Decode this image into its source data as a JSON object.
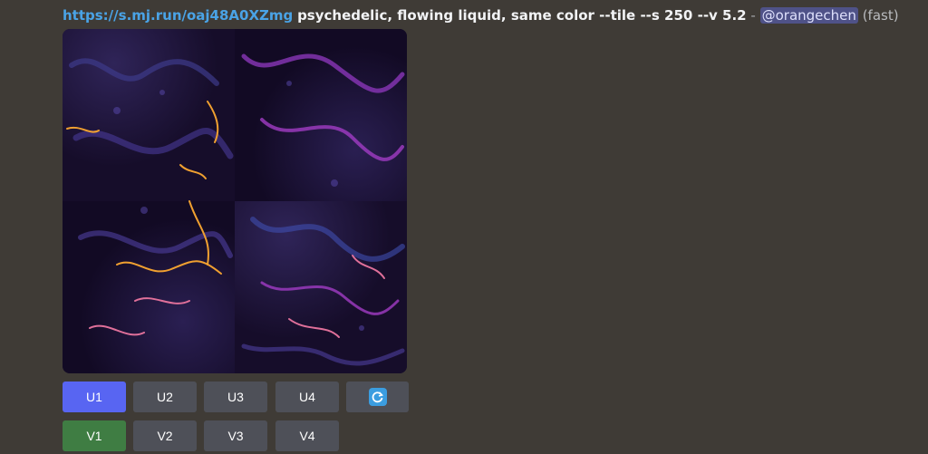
{
  "message": {
    "link": "https://s.mj.run/oaj48A0XZmg",
    "prompt": "psychedelic, flowing liquid, same color --tile --s 250 --v 5.2",
    "separator": "-",
    "mention": "@orangechen",
    "speed": "(fast)"
  },
  "upscale_buttons": [
    "U1",
    "U2",
    "U3",
    "U4"
  ],
  "variation_buttons": [
    "V1",
    "V2",
    "V3",
    "V4"
  ],
  "selected": {
    "upscale": "U1",
    "variation": "V1"
  },
  "icons": {
    "reroll": "reroll-icon"
  },
  "colors": {
    "background": "#3f3b36",
    "link": "#4aa3e6",
    "upscale_selected": "#5865f2",
    "variation_selected": "#3f7d43",
    "button": "#4e5058"
  }
}
